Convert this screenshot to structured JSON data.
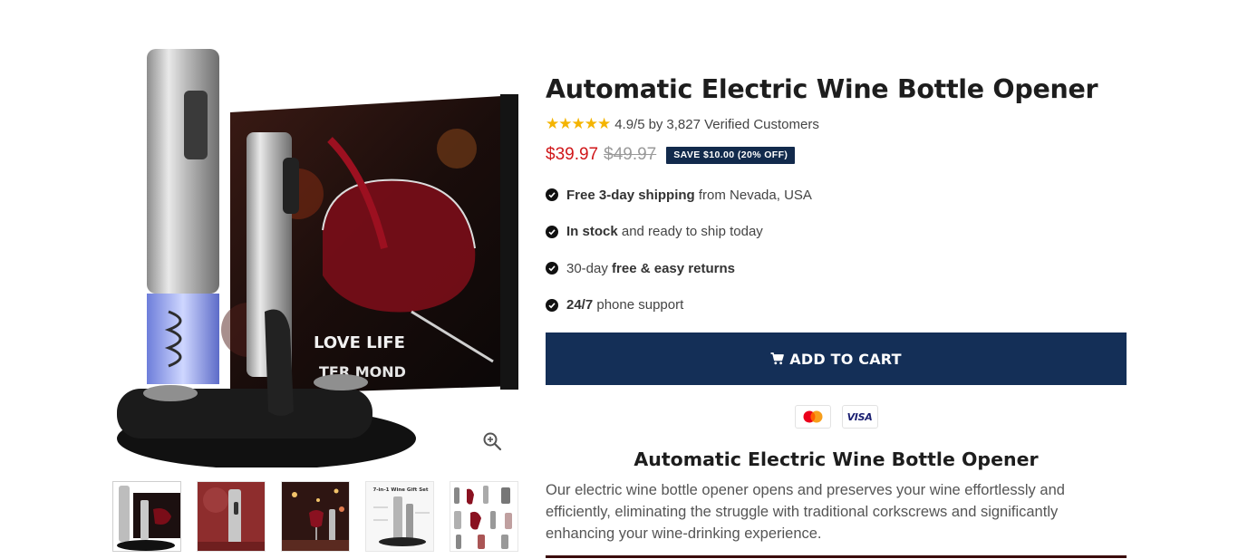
{
  "product": {
    "title": "Automatic Electric Wine Bottle Opener",
    "rating": {
      "stars": "★★★★★",
      "score": "4.9/5",
      "by": "by",
      "text": "3,827 Verified Customers"
    },
    "price": {
      "current": "$39.97",
      "original": "$49.97",
      "save_badge": "SAVE $10.00 (20% OFF)"
    },
    "features": [
      {
        "bold": "Free 3-day shipping",
        "pre": "",
        "post": " from Nevada, USA"
      },
      {
        "bold": "In stock",
        "pre": "",
        "post": " and ready to ship today"
      },
      {
        "bold": "free & easy returns",
        "pre": "30-day ",
        "post": ""
      },
      {
        "bold": "24/7",
        "pre": "",
        "post": " phone support"
      }
    ],
    "add_to_cart_label": "ADD TO CART",
    "payments": {
      "mastercard": "mastercard-icon",
      "visa_label": "VISA"
    },
    "description": {
      "title": "Automatic Electric Wine Bottle Opener",
      "body": "Our electric wine bottle opener opens and preserves your wine effortlessly and efficiently, eliminating the struggle with traditional corkscrews and significantly enhancing your wine-drinking experience."
    }
  },
  "gallery": {
    "main_image_box_text": "LOVE LIFE",
    "main_image_box_subtext": "TER MOND",
    "thumb_box_label": "7-in-1 Wine Gift Set",
    "icons": {
      "zoom": "zoom-in-icon",
      "cart": "cart-icon",
      "check": "check-circle-icon"
    }
  },
  "colors": {
    "accent_navy": "#142f57",
    "price_red": "#d0171a",
    "star_gold": "#f4b400"
  }
}
